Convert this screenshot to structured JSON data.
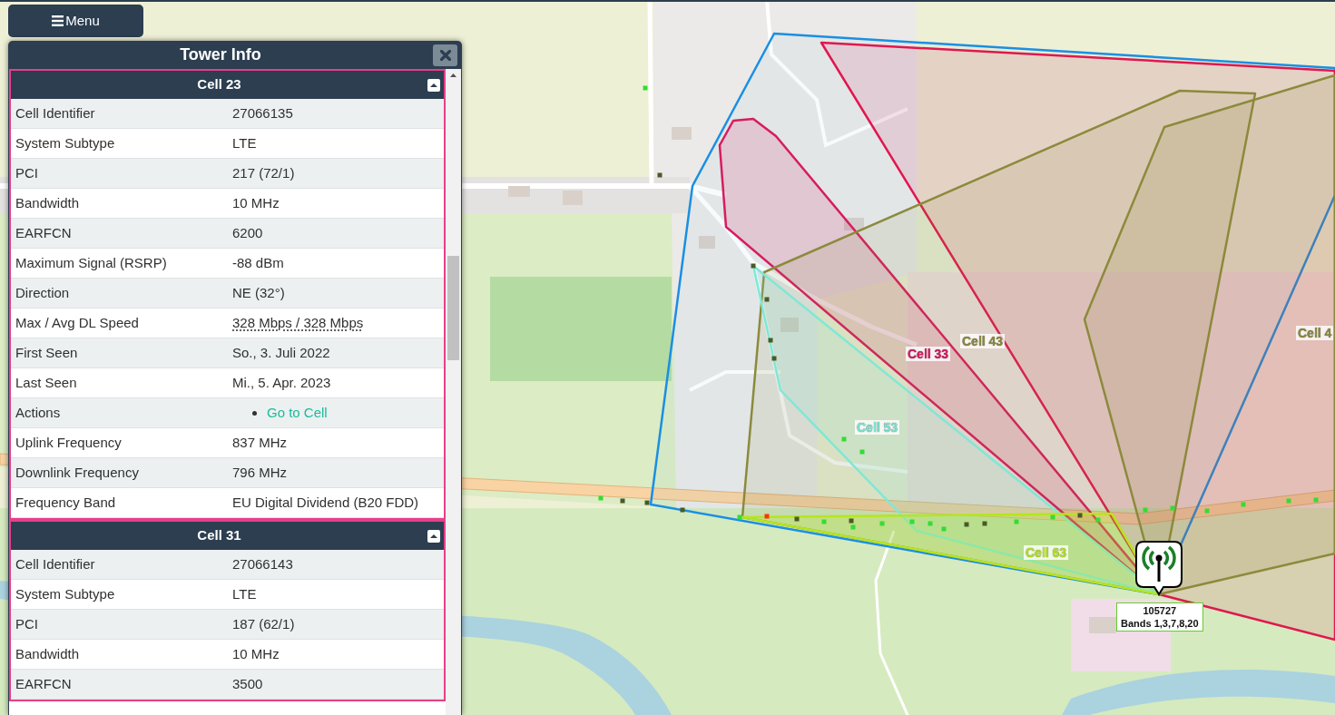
{
  "menu_button": {
    "label": "Menu"
  },
  "panel": {
    "title": "Tower Info",
    "cells": [
      {
        "title": "Cell 23",
        "expanded": true,
        "rows": [
          {
            "kind": "text",
            "label": "Cell Identifier",
            "value": "27066135"
          },
          {
            "kind": "text",
            "label": "System Subtype",
            "value": "LTE"
          },
          {
            "kind": "text",
            "label": "PCI",
            "value": "217 (72/1)"
          },
          {
            "kind": "text",
            "label": "Bandwidth",
            "value": "10 MHz"
          },
          {
            "kind": "text",
            "label": "EARFCN",
            "value": "6200"
          },
          {
            "kind": "text",
            "label": "Maximum Signal (RSRP)",
            "value": "-88 dBm"
          },
          {
            "kind": "text",
            "label": "Direction",
            "value": "NE (32°)"
          },
          {
            "kind": "abbr",
            "label": "Max / Avg DL Speed",
            "value": "328 Mbps / 328 Mbps"
          },
          {
            "kind": "text",
            "label": "First Seen",
            "value": "So., 3. Juli 2022"
          },
          {
            "kind": "text",
            "label": "Last Seen",
            "value": "Mi., 5. Apr. 2023"
          },
          {
            "kind": "actions",
            "label": "Actions",
            "links": [
              {
                "label": "Go to Cell"
              }
            ]
          },
          {
            "kind": "text",
            "label": "Uplink Frequency",
            "value": "837 MHz"
          },
          {
            "kind": "text",
            "label": "Downlink Frequency",
            "value": "796 MHz"
          },
          {
            "kind": "text",
            "label": "Frequency Band",
            "value": "EU Digital Dividend (B20 FDD)"
          }
        ]
      },
      {
        "title": "Cell 31",
        "expanded": true,
        "rows": [
          {
            "kind": "text",
            "label": "Cell Identifier",
            "value": "27066143"
          },
          {
            "kind": "text",
            "label": "System Subtype",
            "value": "LTE"
          },
          {
            "kind": "text",
            "label": "PCI",
            "value": "187 (62/1)"
          },
          {
            "kind": "text",
            "label": "Bandwidth",
            "value": "10 MHz"
          },
          {
            "kind": "text",
            "label": "EARFCN",
            "value": "3500"
          }
        ]
      }
    ]
  },
  "map": {
    "sectors": [
      {
        "color": "#1a8fe3"
      },
      {
        "color": "#e0174f"
      },
      {
        "label": "Cell 33",
        "color": "#d81b60"
      },
      {
        "label": "Cell 43",
        "color": "#8c8a3c"
      },
      {
        "label": "Cell 4",
        "color": "#8c8a3c"
      },
      {
        "label": "Cell 53",
        "color": "#7ee8d6"
      },
      {
        "label": "Cell 63",
        "color": "#b5e61d"
      }
    ],
    "measurements": [
      {
        "color": "#33dd33"
      },
      {
        "color": "#4a5a23"
      },
      {
        "color": "#4a5a23"
      },
      {
        "color": "#4a5a23"
      },
      {
        "color": "#33dd33"
      },
      {
        "color": "#ff3300"
      },
      {
        "color": "#4a5a23"
      },
      {
        "color": "#33dd33"
      },
      {
        "color": "#4a5a23"
      },
      {
        "color": "#33dd33"
      },
      {
        "color": "#33dd33"
      },
      {
        "color": "#33dd33"
      },
      {
        "color": "#33dd33"
      },
      {
        "color": "#33dd33"
      },
      {
        "color": "#4a5a23"
      },
      {
        "color": "#4a5a23"
      },
      {
        "color": "#33dd33"
      },
      {
        "color": "#33dd33"
      },
      {
        "color": "#4a5a23"
      },
      {
        "color": "#33dd33"
      },
      {
        "color": "#33dd33"
      },
      {
        "color": "#33dd33"
      },
      {
        "color": "#33dd33"
      },
      {
        "color": "#33dd33"
      },
      {
        "color": "#33dd33"
      },
      {
        "color": "#33dd33"
      },
      {
        "color": "#33dd33"
      },
      {
        "color": "#4a5a23"
      },
      {
        "color": "#4a5a23"
      },
      {
        "color": "#4a5a23"
      },
      {
        "color": "#4a5a23"
      },
      {
        "color": "#4a5a23"
      },
      {
        "color": "#33dd33"
      },
      {
        "color": "#33dd33"
      }
    ],
    "tower": {
      "id": "105727",
      "bands": "Bands 1,3,7,8,20"
    }
  }
}
